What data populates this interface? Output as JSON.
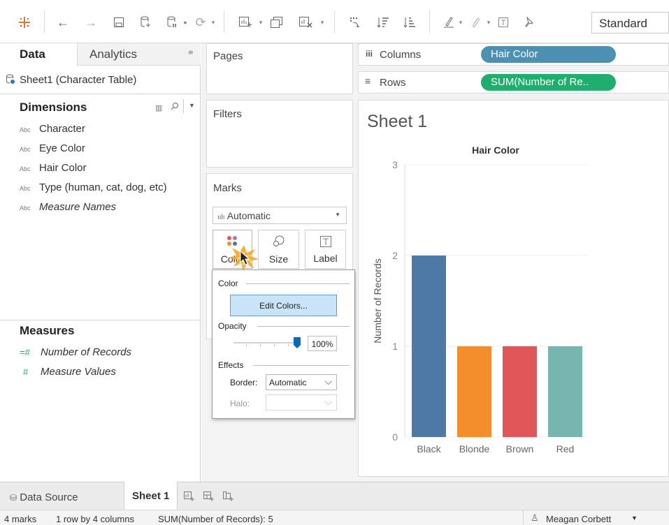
{
  "toolbar": {
    "view_size": "Standard"
  },
  "left": {
    "tab_data": "Data",
    "tab_analytics": "Analytics",
    "datasource": "Sheet1 (Character Table)",
    "dimensions_header": "Dimensions",
    "dimensions": [
      {
        "label": "Character",
        "italic": false
      },
      {
        "label": "Eye Color",
        "italic": false
      },
      {
        "label": "Hair Color",
        "italic": false
      },
      {
        "label": "Type (human, cat, dog, etc)",
        "italic": false
      },
      {
        "label": "Measure Names",
        "italic": true
      }
    ],
    "abc": "Abc",
    "measures_header": "Measures",
    "measures": [
      {
        "label": "Number of Records"
      },
      {
        "label": "Measure Values"
      }
    ]
  },
  "cards": {
    "pages": "Pages",
    "filters": "Filters",
    "marks": "Marks",
    "mark_type": "Automatic",
    "btn_color": "Color",
    "btn_size": "Size",
    "btn_label": "Label"
  },
  "popup": {
    "color_section": "Color",
    "edit_colors": "Edit Colors...",
    "opacity_section": "Opacity",
    "opacity_value": "100%",
    "opacity_level": 1.0,
    "effects_section": "Effects",
    "border_label": "Border:",
    "border_value": "Automatic",
    "halo_label": "Halo:",
    "halo_value": ""
  },
  "shelves": {
    "columns_label": "Columns",
    "columns_pill": "Hair Color",
    "rows_label": "Rows",
    "rows_pill": "SUM(Number of Re.."
  },
  "sheet_title": "Sheet 1",
  "chart_data": {
    "type": "bar",
    "title": "Hair Color",
    "ylabel": "Number of Records",
    "xlabel": "",
    "categories": [
      "Black",
      "Blonde",
      "Brown",
      "Red"
    ],
    "values": [
      2,
      1,
      1,
      1
    ],
    "colors": [
      "#4e79a7",
      "#f28e2b",
      "#e15759",
      "#76b7b2"
    ],
    "yticks": [
      0,
      1,
      2,
      3
    ],
    "ylim": [
      0,
      3
    ],
    "grid": true
  },
  "tabs": {
    "data_source": "Data Source",
    "sheet": "Sheet 1"
  },
  "status": {
    "marks": "4 marks",
    "rows_cols": "1 row by 4 columns",
    "sum": "SUM(Number of Records): 5",
    "user": "Meagan Corbett"
  },
  "colors": {
    "columns_pill": "#4b91b4",
    "rows_pill": "#1fae6d",
    "accent": "#0b6ab6"
  }
}
